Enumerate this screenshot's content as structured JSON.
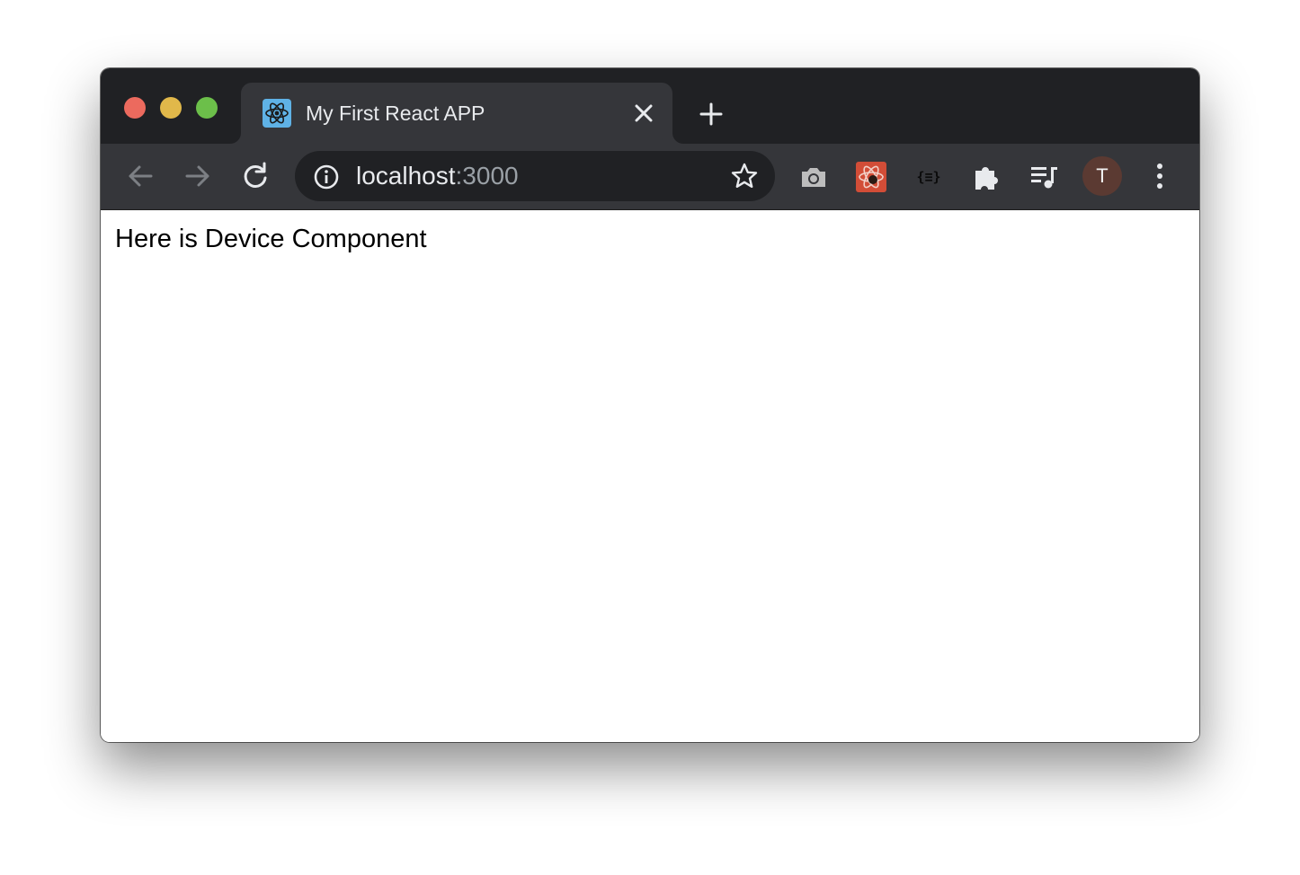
{
  "window": {
    "controls": {
      "close": "close-window",
      "minimize": "minimize-window",
      "maximize": "maximize-window"
    }
  },
  "tab": {
    "title": "My First React APP",
    "favicon": "react-icon",
    "close_icon": "close-icon"
  },
  "new_tab": {
    "icon": "plus-icon"
  },
  "toolbar": {
    "back_icon": "arrow-left-icon",
    "forward_icon": "arrow-right-icon",
    "reload_icon": "reload-icon",
    "url": {
      "host": "localhost",
      "port": ":3000"
    },
    "info_icon": "info-icon",
    "bookmark_icon": "star-icon",
    "extensions": [
      {
        "name": "camera-icon"
      },
      {
        "name": "react-devtools-icon"
      },
      {
        "name": "json-formatter-icon",
        "label": "{≡}"
      },
      {
        "name": "puzzle-icon"
      },
      {
        "name": "media-playlist-icon"
      }
    ],
    "profile_initial": "T",
    "menu_icon": "kebab-menu-icon"
  },
  "page": {
    "text": "Here is Device Component"
  },
  "colors": {
    "tabstrip_bg": "#202124",
    "toolbar_bg": "#35363a",
    "omnibox_bg": "#202124",
    "close": "#ec6a5e",
    "minimize": "#e1b84a",
    "maximize": "#6cbf4a",
    "avatar_bg": "#5b3a32",
    "devtools_bg": "#d24d37"
  }
}
